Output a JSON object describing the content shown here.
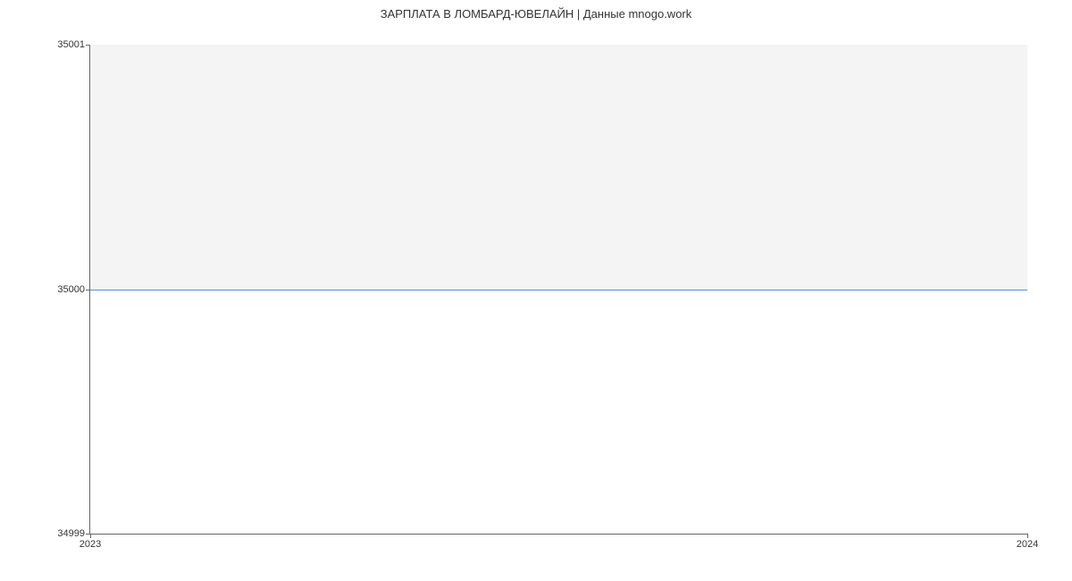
{
  "chart_data": {
    "type": "line",
    "title": "ЗАРПЛАТА В ЛОМБАРД-ЮВЕЛАЙН | Данные mnogo.work",
    "x": [
      2023,
      2024
    ],
    "values": [
      35000,
      35000
    ],
    "xlabel": "",
    "ylabel": "",
    "xlim": [
      2023,
      2024
    ],
    "ylim": [
      34999,
      35001
    ],
    "x_ticks": [
      "2023",
      "2024"
    ],
    "y_ticks": [
      "34999",
      "35000",
      "35001"
    ],
    "line_color": "#5b8fd6",
    "shaded_region": {
      "y_from": 35000,
      "y_to": 35001,
      "color": "#f4f4f4"
    }
  }
}
